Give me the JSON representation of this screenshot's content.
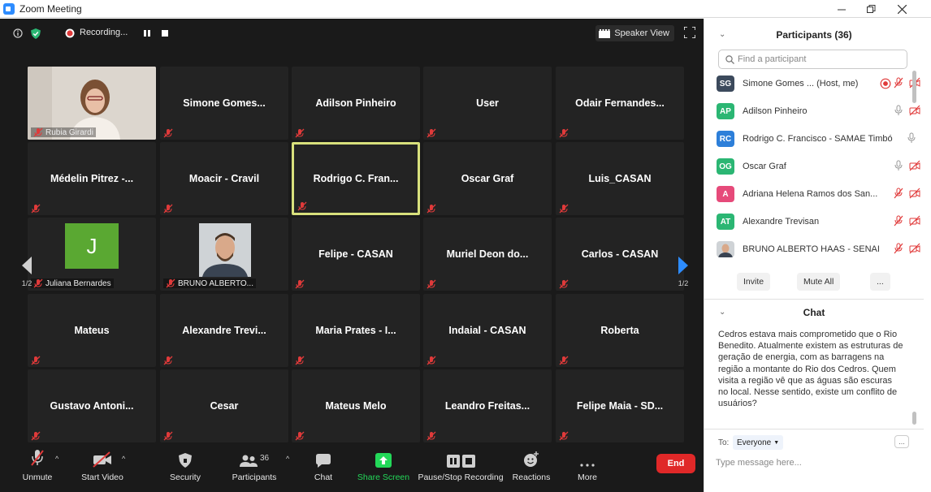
{
  "window": {
    "title": "Zoom Meeting"
  },
  "top_bar": {
    "recording_label": "Recording...",
    "speaker_view_label": "Speaker View"
  },
  "grid": {
    "page_left": "1/2",
    "page_right": "1/2",
    "tiles": [
      {
        "name": "",
        "label": "Rubia Girardi",
        "type": "video"
      },
      {
        "name": "Simone Gomes...",
        "type": "name"
      },
      {
        "name": "Adilson Pinheiro",
        "type": "name"
      },
      {
        "name": "User",
        "type": "name"
      },
      {
        "name": "Odair Fernandes...",
        "type": "name"
      },
      {
        "name": "Médelin Pitrez -...",
        "type": "name"
      },
      {
        "name": "Moacir - Cravil",
        "type": "name"
      },
      {
        "name": "Rodrigo C. Fran...",
        "type": "name",
        "active": true
      },
      {
        "name": "Oscar Graf",
        "type": "name"
      },
      {
        "name": "Luis_CASAN",
        "type": "name"
      },
      {
        "name": "",
        "label": "Juliana Bernardes",
        "avatar_letter": "J",
        "type": "avatar"
      },
      {
        "name": "",
        "label": "BRUNO ALBERTO...",
        "type": "photo"
      },
      {
        "name": "Felipe - CASAN",
        "type": "name"
      },
      {
        "name": "Muriel Deon do...",
        "type": "name"
      },
      {
        "name": "Carlos - CASAN",
        "type": "name"
      },
      {
        "name": "Mateus",
        "type": "name"
      },
      {
        "name": "Alexandre Trevi...",
        "type": "name"
      },
      {
        "name": "Maria Prates - I...",
        "type": "name"
      },
      {
        "name": "Indaial - CASAN",
        "type": "name"
      },
      {
        "name": "Roberta",
        "type": "name"
      },
      {
        "name": "Gustavo Antoni...",
        "type": "name"
      },
      {
        "name": "Cesar",
        "type": "name"
      },
      {
        "name": "Mateus Melo",
        "type": "name"
      },
      {
        "name": "Leandro Freitas...",
        "type": "name"
      },
      {
        "name": "Felipe Maia - SD...",
        "type": "name"
      }
    ]
  },
  "toolbar": {
    "unmute": "Unmute",
    "start_video": "Start Video",
    "security": "Security",
    "participants": "Participants",
    "participants_count": "36",
    "chat": "Chat",
    "share_screen": "Share Screen",
    "pause_stop_recording": "Pause/Stop Recording",
    "reactions": "Reactions",
    "more": "More",
    "end": "End"
  },
  "participants_panel": {
    "title": "Participants (36)",
    "search_placeholder": "Find a participant",
    "items": [
      {
        "initials": "SG",
        "name": "Simone Gomes ... (Host, me)",
        "color": "#3c4a5c"
      },
      {
        "initials": "AP",
        "name": "Adilson Pinheiro",
        "color": "#2bb673"
      },
      {
        "initials": "RC",
        "name": "Rodrigo C. Francisco - SAMAE Timbó",
        "color": "#2d7fd9"
      },
      {
        "initials": "OG",
        "name": "Oscar Graf",
        "color": "#2bb673"
      },
      {
        "initials": "A",
        "name": "Adriana Helena Ramos dos San...",
        "color": "#e64a7a"
      },
      {
        "initials": "AT",
        "name": "Alexandre Trevisan",
        "color": "#2bb673"
      },
      {
        "initials": "",
        "name": "BRUNO ALBERTO HAAS - SENAI",
        "color": "#8a7b6a"
      }
    ],
    "invite": "Invite",
    "mute_all": "Mute All",
    "more": "..."
  },
  "chat_panel": {
    "title": "Chat",
    "message": "Cedros estava mais comprometido que o Rio Benedito. Atualmente existem as estruturas de geração de energia, com as barragens na região a montante do Rio dos Cedros. Quem visita a região vê que as águas são escuras no local. Nesse sentido, existe um conflito de usuários?",
    "to_label": "To:",
    "to_value": "Everyone",
    "more": "...",
    "input_placeholder": "Type message here..."
  },
  "colors": {
    "accent": "#2d8cff",
    "end": "#e02828",
    "active_border": "#d8e07c",
    "share_green": "#23d959",
    "mute_red": "#e03a3a"
  }
}
